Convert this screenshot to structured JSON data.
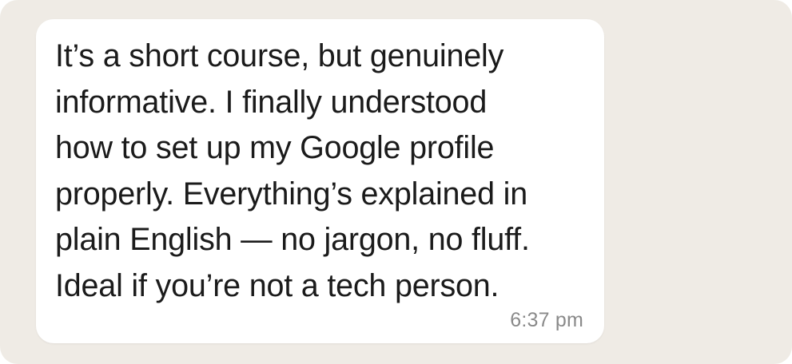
{
  "message": {
    "text": "It’s a short course, but genuinely\ninformative. I finally understood\nhow to set up my Google profile\nproperly. Everything’s explained in\nplain English — no jargon, no fluff.\nIdeal if you’re not a tech person.",
    "time": "6:37 pm"
  },
  "colors": {
    "background": "#efebe5",
    "bubble": "#ffffff",
    "text": "#1b1b1b",
    "timestamp": "#8a8a8a"
  }
}
